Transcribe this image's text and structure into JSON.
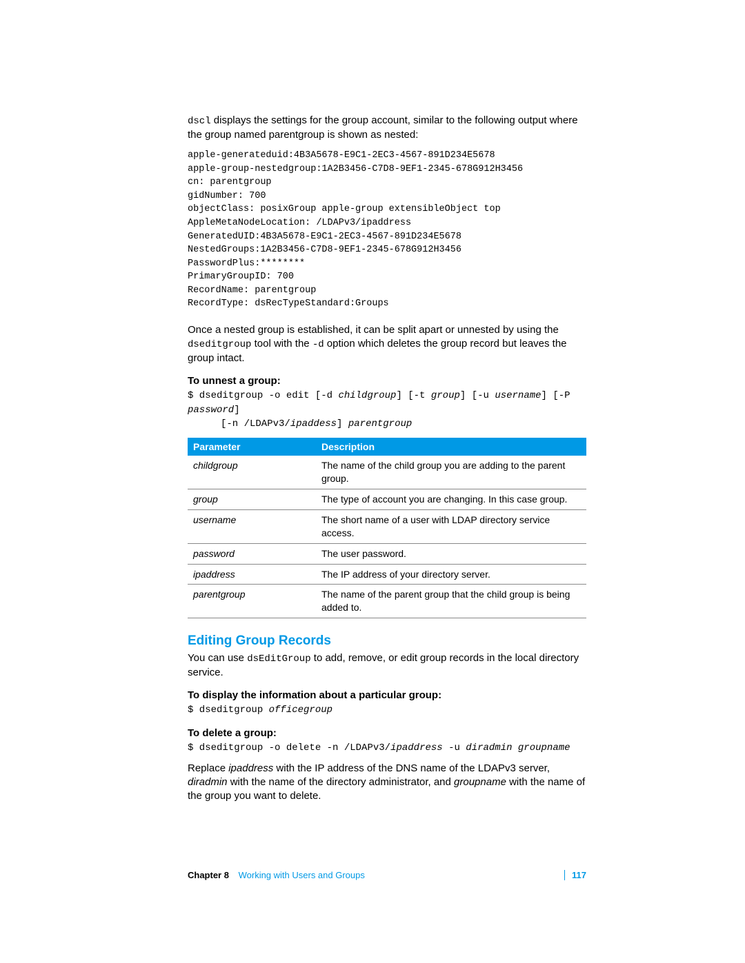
{
  "intro": {
    "dscl_cmd": "dscl",
    "intro_text_1": " displays the settings for the group account, similar to the following output where the group named parentgroup is shown as nested:"
  },
  "output_block": "apple-generateduid:4B3A5678-E9C1-2EC3-4567-891D234E5678\napple-group-nestedgroup:1A2B3456-C7D8-9EF1-2345-678G912H3456\ncn: parentgroup\ngidNumber: 700\nobjectClass: posixGroup apple-group extensibleObject top\nAppleMetaNodeLocation: /LDAPv3/ipaddress\nGeneratedUID:4B3A5678-E9C1-2EC3-4567-891D234E5678\nNestedGroups:1A2B3456-C7D8-9EF1-2345-678G912H3456\nPasswordPlus:********\nPrimaryGroupID: 700\nRecordName: parentgroup\nRecordType: dsRecTypeStandard:Groups",
  "nested_para": {
    "part1": "Once a nested group is established, it can be split apart or unnested by using the ",
    "cmd1": "dseditgroup",
    "part2": " tool with the ",
    "cmd2": "-d",
    "part3": " option which deletes the group record but leaves the group intact."
  },
  "unnest": {
    "heading": "To unnest a group:",
    "line1": {
      "a": "$ dseditgroup -o edit [-d ",
      "b": "childgroup",
      "c": "] [-t ",
      "d": "group",
      "e": "] [-u ",
      "f": "username",
      "g": "] [-P ",
      "h": "password",
      "i": "]"
    },
    "line2": {
      "a": "[-n /LDAPv3/",
      "b": "ipaddess",
      "c": "] ",
      "d": "parentgroup"
    }
  },
  "table": {
    "headers": {
      "p": "Parameter",
      "d": "Description"
    },
    "rows": [
      {
        "p": "childgroup",
        "d": "The name of the child group you are adding to the parent group."
      },
      {
        "p": "group",
        "d": "The type of account you are changing. In this case group."
      },
      {
        "p": "username",
        "d": "The short name of a user with LDAP directory service access."
      },
      {
        "p": "password",
        "d": "The user password."
      },
      {
        "p": "ipaddress",
        "d": "The IP address of your directory server."
      },
      {
        "p": "parentgroup",
        "d": "The name of the parent group that the child group is being added to."
      }
    ]
  },
  "editing": {
    "heading": "Editing Group Records",
    "para": {
      "a": "You can use ",
      "b": "dsEditGroup",
      "c": " to add, remove, or edit group records in the local directory service."
    }
  },
  "display": {
    "heading": "To display the information about a particular group:",
    "cmd": {
      "a": "$ dseditgroup ",
      "b": "officegroup"
    }
  },
  "delete": {
    "heading": "To delete a group:",
    "cmd": {
      "a": "$ dseditgroup -o delete -n /LDAPv3/",
      "b": "ipaddress",
      "c": " -u ",
      "d": "diradmin groupname"
    },
    "para": {
      "a": "Replace ",
      "b": "ipaddress",
      "c": " with the IP address of the DNS name of the LDAPv3 server, ",
      "d": "diradmin",
      "e": " with the name of the directory administrator, and ",
      "f": "groupname",
      "g": " with the name of the group you want to delete."
    }
  },
  "footer": {
    "chapter_label": "Chapter 8",
    "chapter_title": "Working with Users and Groups",
    "page_num": "117"
  }
}
